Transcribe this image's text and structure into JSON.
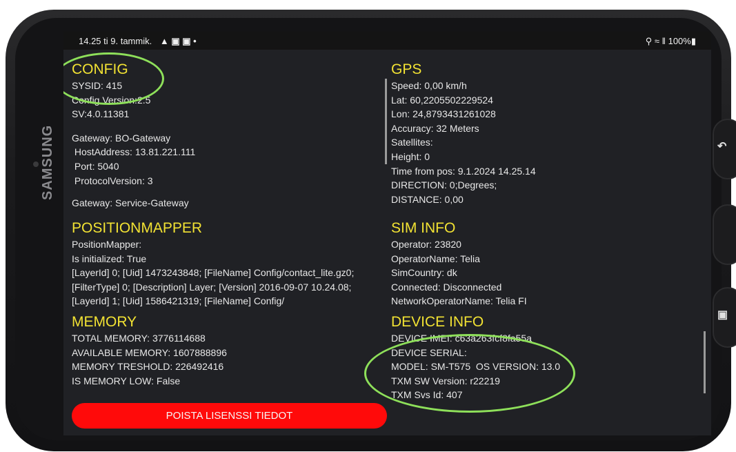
{
  "device": {
    "brand": "SAMSUNG"
  },
  "statusbar": {
    "time_date": "14.25  ti 9. tammik.",
    "icons_left": "▲ ▣ ▣  •",
    "right": "⚲ ≈ ‖ 100%▮"
  },
  "config": {
    "title": "CONFIG",
    "lines": [
      "SYSID: 415",
      "Config Version:2.5",
      "SV:4.0.11381"
    ],
    "lines2": [
      "Gateway: BO-Gateway",
      " HostAddress: 13.81.221.111",
      " Port: 5040",
      " ProtocolVersion: 3"
    ],
    "cut": "Gateway: Service-Gateway"
  },
  "gps": {
    "title": "GPS",
    "lines": [
      "Speed: 0,00 km/h",
      "Lat: 60,2205502229524",
      "Lon: 24,8793431261028",
      "Accuracy: 32 Meters",
      "Satellites:",
      "Height: 0",
      "Time from pos: 9.1.2024 14.25.14",
      "DIRECTION: 0;Degrees;",
      "DISTANCE: 0,00"
    ]
  },
  "positionmapper": {
    "title": "POSITIONMAPPER",
    "lines": [
      "PositionMapper:",
      "Is initialized: True",
      "[LayerId] 0; [Uid] 1473243848; [FileName] Config/contact_lite.gz0;",
      "[FilterType] 0; [Description] Layer; [Version] 2016-09-07 10.24.08;",
      "[LayerId] 1; [Uid] 1586421319; [FileName] Config/"
    ]
  },
  "siminfo": {
    "title": "SIM INFO",
    "lines": [
      "Operator: 23820",
      "OperatorName: Telia",
      "SimCountry: dk",
      "Connected: Disconnected",
      "NetworkOperatorName: Telia FI"
    ]
  },
  "memory": {
    "title": "MEMORY",
    "lines": [
      "TOTAL MEMORY: 3776114688",
      "AVAILABLE MEMORY: 1607888896",
      "MEMORY TRESHOLD: 226492416",
      "IS MEMORY LOW: False"
    ]
  },
  "deviceinfo": {
    "title": "DEVICE INFO",
    "lines": [
      "DEVICE IMEI: c63a263fcf8fa55a",
      "DEVICE SERIAL:",
      "MODEL: SM-T575  OS VERSION: 13.0",
      "TXM SW Version: r22219",
      "TXM Svs Id: 407"
    ]
  },
  "button": {
    "label": "POISTA LISENSSI TIEDOT"
  },
  "colors": {
    "heading": "#f2e233",
    "button": "#ff0a0a",
    "annotation": "#8ee05a",
    "background": "#202125"
  }
}
